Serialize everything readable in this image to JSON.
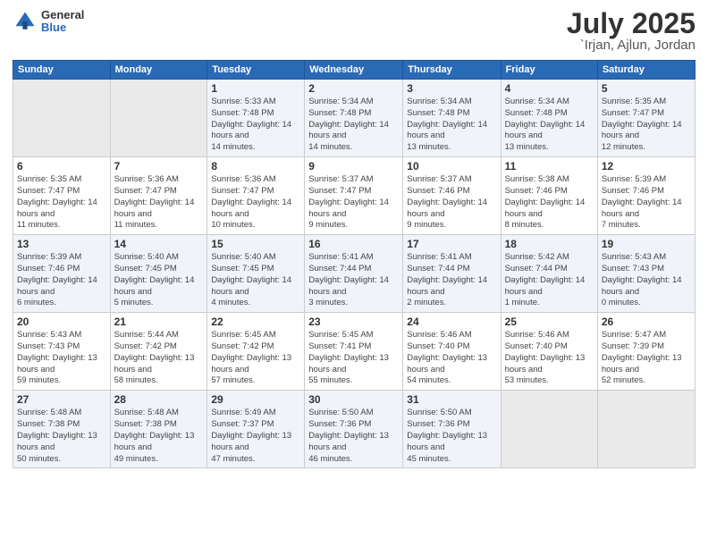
{
  "logo": {
    "general": "General",
    "blue": "Blue"
  },
  "header": {
    "title": "July 2025",
    "subtitle": "`Irjan, Ajlun, Jordan"
  },
  "weekdays": [
    "Sunday",
    "Monday",
    "Tuesday",
    "Wednesday",
    "Thursday",
    "Friday",
    "Saturday"
  ],
  "weeks": [
    [
      {
        "day": null
      },
      {
        "day": null
      },
      {
        "day": "1",
        "sunrise": "Sunrise: 5:33 AM",
        "sunset": "Sunset: 7:48 PM",
        "daylight": "Daylight: 14 hours and 14 minutes."
      },
      {
        "day": "2",
        "sunrise": "Sunrise: 5:34 AM",
        "sunset": "Sunset: 7:48 PM",
        "daylight": "Daylight: 14 hours and 14 minutes."
      },
      {
        "day": "3",
        "sunrise": "Sunrise: 5:34 AM",
        "sunset": "Sunset: 7:48 PM",
        "daylight": "Daylight: 14 hours and 13 minutes."
      },
      {
        "day": "4",
        "sunrise": "Sunrise: 5:34 AM",
        "sunset": "Sunset: 7:48 PM",
        "daylight": "Daylight: 14 hours and 13 minutes."
      },
      {
        "day": "5",
        "sunrise": "Sunrise: 5:35 AM",
        "sunset": "Sunset: 7:47 PM",
        "daylight": "Daylight: 14 hours and 12 minutes."
      }
    ],
    [
      {
        "day": "6",
        "sunrise": "Sunrise: 5:35 AM",
        "sunset": "Sunset: 7:47 PM",
        "daylight": "Daylight: 14 hours and 11 minutes."
      },
      {
        "day": "7",
        "sunrise": "Sunrise: 5:36 AM",
        "sunset": "Sunset: 7:47 PM",
        "daylight": "Daylight: 14 hours and 11 minutes."
      },
      {
        "day": "8",
        "sunrise": "Sunrise: 5:36 AM",
        "sunset": "Sunset: 7:47 PM",
        "daylight": "Daylight: 14 hours and 10 minutes."
      },
      {
        "day": "9",
        "sunrise": "Sunrise: 5:37 AM",
        "sunset": "Sunset: 7:47 PM",
        "daylight": "Daylight: 14 hours and 9 minutes."
      },
      {
        "day": "10",
        "sunrise": "Sunrise: 5:37 AM",
        "sunset": "Sunset: 7:46 PM",
        "daylight": "Daylight: 14 hours and 9 minutes."
      },
      {
        "day": "11",
        "sunrise": "Sunrise: 5:38 AM",
        "sunset": "Sunset: 7:46 PM",
        "daylight": "Daylight: 14 hours and 8 minutes."
      },
      {
        "day": "12",
        "sunrise": "Sunrise: 5:39 AM",
        "sunset": "Sunset: 7:46 PM",
        "daylight": "Daylight: 14 hours and 7 minutes."
      }
    ],
    [
      {
        "day": "13",
        "sunrise": "Sunrise: 5:39 AM",
        "sunset": "Sunset: 7:46 PM",
        "daylight": "Daylight: 14 hours and 6 minutes."
      },
      {
        "day": "14",
        "sunrise": "Sunrise: 5:40 AM",
        "sunset": "Sunset: 7:45 PM",
        "daylight": "Daylight: 14 hours and 5 minutes."
      },
      {
        "day": "15",
        "sunrise": "Sunrise: 5:40 AM",
        "sunset": "Sunset: 7:45 PM",
        "daylight": "Daylight: 14 hours and 4 minutes."
      },
      {
        "day": "16",
        "sunrise": "Sunrise: 5:41 AM",
        "sunset": "Sunset: 7:44 PM",
        "daylight": "Daylight: 14 hours and 3 minutes."
      },
      {
        "day": "17",
        "sunrise": "Sunrise: 5:41 AM",
        "sunset": "Sunset: 7:44 PM",
        "daylight": "Daylight: 14 hours and 2 minutes."
      },
      {
        "day": "18",
        "sunrise": "Sunrise: 5:42 AM",
        "sunset": "Sunset: 7:44 PM",
        "daylight": "Daylight: 14 hours and 1 minute."
      },
      {
        "day": "19",
        "sunrise": "Sunrise: 5:43 AM",
        "sunset": "Sunset: 7:43 PM",
        "daylight": "Daylight: 14 hours and 0 minutes."
      }
    ],
    [
      {
        "day": "20",
        "sunrise": "Sunrise: 5:43 AM",
        "sunset": "Sunset: 7:43 PM",
        "daylight": "Daylight: 13 hours and 59 minutes."
      },
      {
        "day": "21",
        "sunrise": "Sunrise: 5:44 AM",
        "sunset": "Sunset: 7:42 PM",
        "daylight": "Daylight: 13 hours and 58 minutes."
      },
      {
        "day": "22",
        "sunrise": "Sunrise: 5:45 AM",
        "sunset": "Sunset: 7:42 PM",
        "daylight": "Daylight: 13 hours and 57 minutes."
      },
      {
        "day": "23",
        "sunrise": "Sunrise: 5:45 AM",
        "sunset": "Sunset: 7:41 PM",
        "daylight": "Daylight: 13 hours and 55 minutes."
      },
      {
        "day": "24",
        "sunrise": "Sunrise: 5:46 AM",
        "sunset": "Sunset: 7:40 PM",
        "daylight": "Daylight: 13 hours and 54 minutes."
      },
      {
        "day": "25",
        "sunrise": "Sunrise: 5:46 AM",
        "sunset": "Sunset: 7:40 PM",
        "daylight": "Daylight: 13 hours and 53 minutes."
      },
      {
        "day": "26",
        "sunrise": "Sunrise: 5:47 AM",
        "sunset": "Sunset: 7:39 PM",
        "daylight": "Daylight: 13 hours and 52 minutes."
      }
    ],
    [
      {
        "day": "27",
        "sunrise": "Sunrise: 5:48 AM",
        "sunset": "Sunset: 7:38 PM",
        "daylight": "Daylight: 13 hours and 50 minutes."
      },
      {
        "day": "28",
        "sunrise": "Sunrise: 5:48 AM",
        "sunset": "Sunset: 7:38 PM",
        "daylight": "Daylight: 13 hours and 49 minutes."
      },
      {
        "day": "29",
        "sunrise": "Sunrise: 5:49 AM",
        "sunset": "Sunset: 7:37 PM",
        "daylight": "Daylight: 13 hours and 47 minutes."
      },
      {
        "day": "30",
        "sunrise": "Sunrise: 5:50 AM",
        "sunset": "Sunset: 7:36 PM",
        "daylight": "Daylight: 13 hours and 46 minutes."
      },
      {
        "day": "31",
        "sunrise": "Sunrise: 5:50 AM",
        "sunset": "Sunset: 7:36 PM",
        "daylight": "Daylight: 13 hours and 45 minutes."
      },
      {
        "day": null
      },
      {
        "day": null
      }
    ]
  ]
}
